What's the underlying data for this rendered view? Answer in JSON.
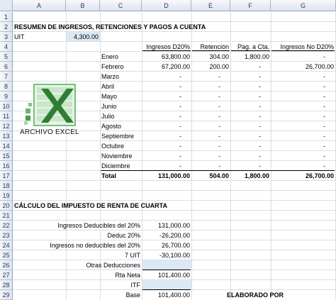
{
  "columns": [
    "A",
    "B",
    "C",
    "D",
    "E",
    "F",
    "G"
  ],
  "rows": [
    "1",
    "2",
    "3",
    "4",
    "5",
    "6",
    "7",
    "8",
    "9",
    "10",
    "11",
    "12",
    "13",
    "14",
    "15",
    "16",
    "17",
    "18",
    "19",
    "20",
    "21",
    "22",
    "23",
    "24",
    "25",
    "26",
    "27",
    "28",
    "29"
  ],
  "title": "RESUMEN DE INGRESOS, RETENCIONES Y PAGOS A CUENTA",
  "uit": {
    "label": "UIT",
    "value": "4,300.00"
  },
  "table_headers": [
    "Ingresos D20%",
    "Retención",
    "Pag. a Cta.",
    "Ingresos No D20%"
  ],
  "months": [
    {
      "month": "Enero",
      "d20": "63,800.00",
      "ret": "304.00",
      "pag": "1,800.00",
      "nod20": "-"
    },
    {
      "month": "Febrero",
      "d20": "67,200.00",
      "ret": "200.00",
      "pag": "-",
      "nod20": "26,700.00"
    },
    {
      "month": "Marzo",
      "d20": "-",
      "ret": "-",
      "pag": "-",
      "nod20": "-"
    },
    {
      "month": "Abril",
      "d20": "-",
      "ret": "-",
      "pag": "-",
      "nod20": "-"
    },
    {
      "month": "Mayo",
      "d20": "-",
      "ret": "-",
      "pag": "-",
      "nod20": "-"
    },
    {
      "month": "Junio",
      "d20": "-",
      "ret": "-",
      "pag": "-",
      "nod20": "-"
    },
    {
      "month": "Julio",
      "d20": "-",
      "ret": "-",
      "pag": "-",
      "nod20": "-"
    },
    {
      "month": "Agosto",
      "d20": "-",
      "ret": "-",
      "pag": "-",
      "nod20": "-"
    },
    {
      "month": "Septiembre",
      "d20": "-",
      "ret": "-",
      "pag": "-",
      "nod20": "-"
    },
    {
      "month": "Octubre",
      "d20": "-",
      "ret": "-",
      "pag": "-",
      "nod20": "-"
    },
    {
      "month": "Noviembre",
      "d20": "-",
      "ret": "-",
      "pag": "-",
      "nod20": "-"
    },
    {
      "month": "Diciembre",
      "d20": "-",
      "ret": "-",
      "pag": "-",
      "nod20": "-"
    }
  ],
  "total": {
    "label": "Total",
    "d20": "131,000.00",
    "ret": "504.00",
    "pag": "1,800.00",
    "nod20": "26,700.00"
  },
  "calc_title": "CÁLCULO DEL IMPUESTO DE RENTA DE CUARTA",
  "calc_rows": [
    {
      "label": "Ingresos Deducibles del 20%",
      "value": "131,000.00"
    },
    {
      "label": "Deduc  20%",
      "value": "-26,200.00"
    },
    {
      "label": "Ingresos no deducibles del 20%",
      "value": "26,700.00"
    },
    {
      "label": "7 UIT",
      "value": "-30,100.00"
    },
    {
      "label": "Otras Deducciones",
      "value": ""
    },
    {
      "label": "Rta Neta",
      "value": "101,400.00"
    },
    {
      "label": "ITF",
      "value": ""
    },
    {
      "label": "Base",
      "value": "101,400.00"
    }
  ],
  "elaborado": "ELABORADO POR",
  "logo_text": "ARCHIVO EXCEL",
  "colors": {
    "input_fill": "#dbe9f4",
    "logo_green": "#2e7d32"
  }
}
